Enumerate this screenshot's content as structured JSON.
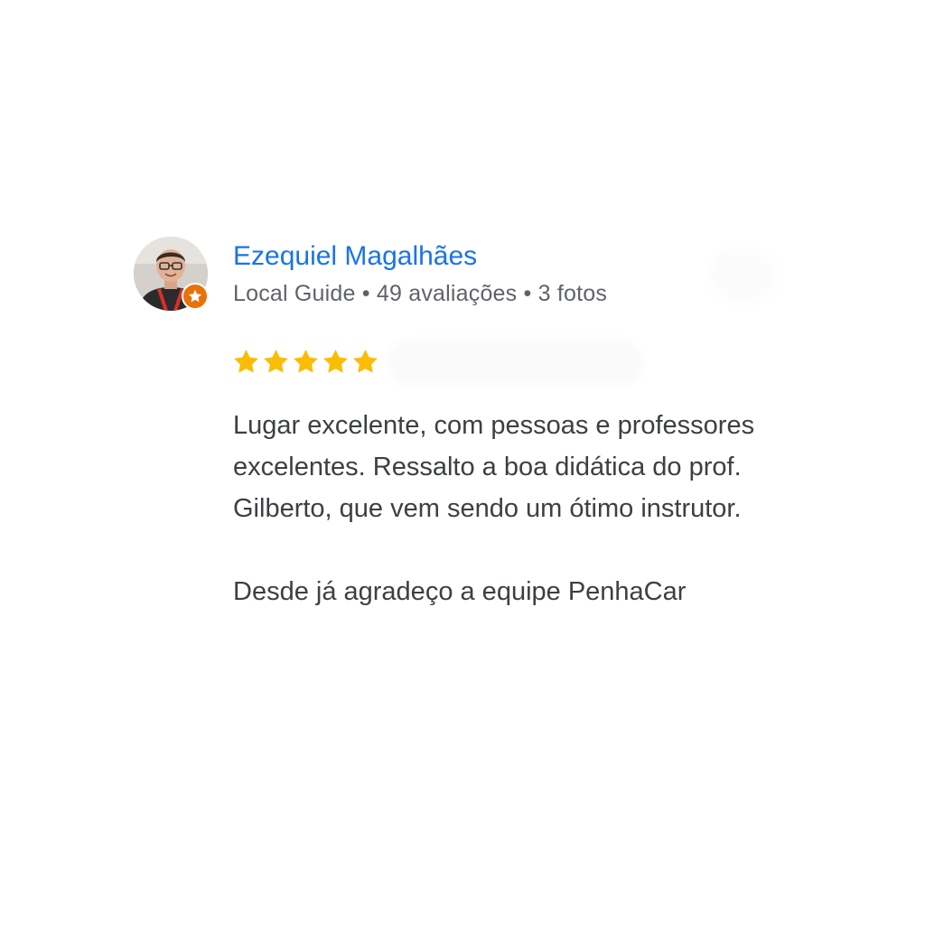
{
  "reviewer": {
    "name": "Ezequiel Magalhães",
    "meta": "Local Guide • 49 avaliações • 3 fotos",
    "badge_icon": "local-guide-star-icon",
    "badge_color": "#e8710a"
  },
  "rating": {
    "stars": 5,
    "max": 5,
    "star_color": "#fbbc04"
  },
  "review": {
    "paragraph_1": "Lugar excelente, com pessoas e professores excelentes. Ressalto a boa didática do prof. Gilberto, que vem sendo um ótimo instrutor.",
    "paragraph_2": "Desde já agradeço a equipe PenhaCar"
  },
  "colors": {
    "name_link": "#1a73e8",
    "meta_text": "#5f6368",
    "body_text": "#3c4043"
  }
}
